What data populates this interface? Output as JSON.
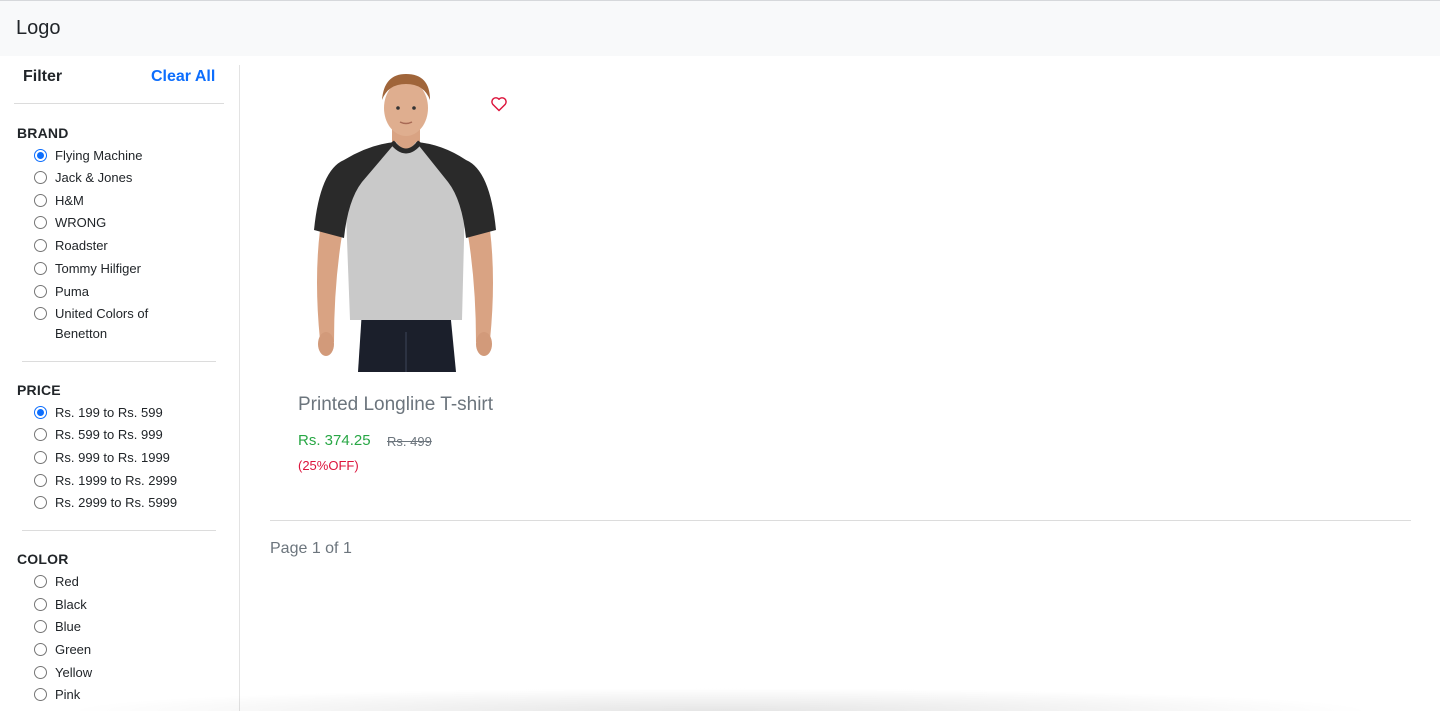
{
  "navbar": {
    "logo": "Logo"
  },
  "sidebar": {
    "filter_title": "Filter",
    "clear_all": "Clear All",
    "sections": [
      {
        "title": "BRAND",
        "options": [
          {
            "label": "Flying Machine",
            "checked": true
          },
          {
            "label": "Jack & Jones",
            "checked": false
          },
          {
            "label": "H&M",
            "checked": false
          },
          {
            "label": "WRONG",
            "checked": false
          },
          {
            "label": "Roadster",
            "checked": false
          },
          {
            "label": "Tommy Hilfiger",
            "checked": false
          },
          {
            "label": "Puma",
            "checked": false
          },
          {
            "label": "United Colors of Benetton",
            "checked": false
          }
        ]
      },
      {
        "title": "PRICE",
        "options": [
          {
            "label": "Rs. 199 to Rs. 599",
            "checked": true
          },
          {
            "label": "Rs. 599 to Rs. 999",
            "checked": false
          },
          {
            "label": "Rs. 999 to Rs. 1999",
            "checked": false
          },
          {
            "label": "Rs. 1999 to Rs. 2999",
            "checked": false
          },
          {
            "label": "Rs. 2999 to Rs. 5999",
            "checked": false
          }
        ]
      },
      {
        "title": "COLOR",
        "options": [
          {
            "label": "Red",
            "checked": false
          },
          {
            "label": "Black",
            "checked": false
          },
          {
            "label": "Blue",
            "checked": false
          },
          {
            "label": "Green",
            "checked": false
          },
          {
            "label": "Yellow",
            "checked": false
          },
          {
            "label": "Pink",
            "checked": false
          }
        ]
      }
    ]
  },
  "product": {
    "name": "Printed Longline T-shirt",
    "price_now": "Rs. 374.25",
    "price_old": "Rs. 499",
    "discount": "(25%OFF)",
    "wishlist_icon": "heart-icon"
  },
  "pagination": {
    "text": "Page 1 of 1"
  },
  "colors": {
    "accent": "#0d6efd",
    "price_green": "#28a745",
    "discount_red": "#dc143c",
    "muted": "#6c757d"
  }
}
